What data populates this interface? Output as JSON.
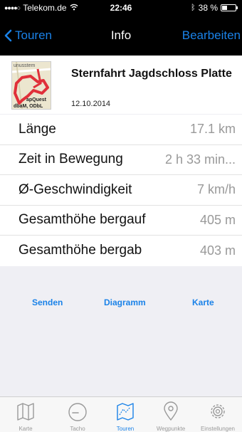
{
  "status_bar": {
    "carrier": "Telekom.de",
    "time": "22:46",
    "battery": "38 %",
    "battery_level": 0.38
  },
  "nav": {
    "back_label": "Touren",
    "title": "Info",
    "edit_label": "Bearbeiten"
  },
  "tour": {
    "name": "Sternfahrt Jagdschloss Platte",
    "date": "12.10.2014",
    "thumbnail_texts": [
      "unusstem",
      "apQuest",
      "dbaM, ODbL"
    ]
  },
  "stats": [
    {
      "label": "Länge",
      "value": "17.1 km"
    },
    {
      "label": "Zeit in Bewegung",
      "value": "2 h 33 min..."
    },
    {
      "label": "Ø-Geschwindigkeit",
      "value": "7 km/h"
    },
    {
      "label": "Gesamthöhe bergauf",
      "value": "405 m"
    },
    {
      "label": "Gesamthöhe bergab",
      "value": "403 m"
    }
  ],
  "actions": {
    "send": "Senden",
    "diagram": "Diagramm",
    "map": "Karte"
  },
  "tabs": [
    {
      "label": "Karte",
      "icon": "map-icon",
      "active": false
    },
    {
      "label": "Tacho",
      "icon": "speedometer-icon",
      "active": false
    },
    {
      "label": "Touren",
      "icon": "tours-icon",
      "active": true
    },
    {
      "label": "Wegpunkte",
      "icon": "waypoint-icon",
      "active": false
    },
    {
      "label": "Einstellungen",
      "icon": "gear-icon",
      "active": false
    }
  ],
  "colors": {
    "accent": "#1a82e8",
    "route": "#e0303a"
  }
}
